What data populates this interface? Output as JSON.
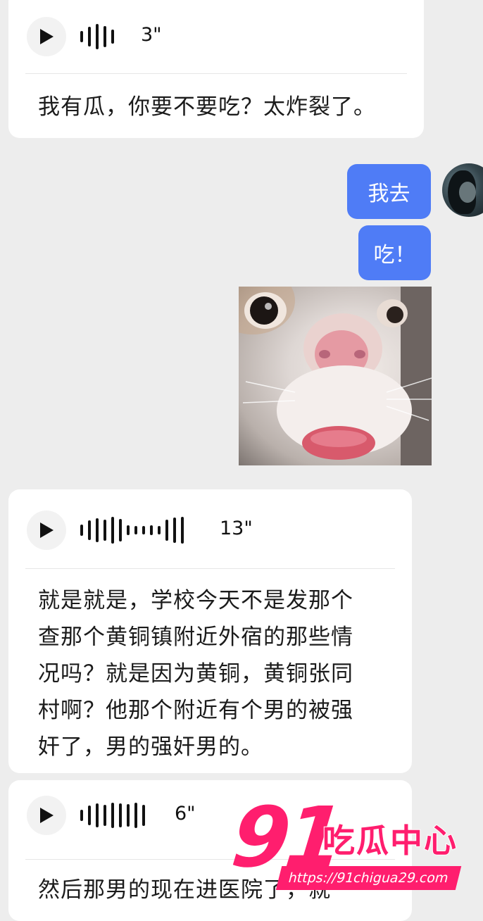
{
  "messages": {
    "voice1": {
      "duration": "3\"",
      "transcript": "我有瓜，你要不要吃？太炸裂了。"
    },
    "outgoing1": {
      "text": "我去"
    },
    "outgoing2": {
      "text": "吃！"
    },
    "voice2": {
      "duration": "13\"",
      "transcript_lines": [
        "就是就是，学校今天不是发那个",
        "查那个黄铜镇附近外宿的那些情",
        "况吗？就是因为黄铜，黄铜张同",
        "村啊？他那个附近有个男的被强",
        "奸了，男的强奸男的。"
      ]
    },
    "voice3": {
      "duration": "6\"",
      "transcript_partial": "然后那男的现在进医院了，就"
    }
  },
  "icons": {
    "play": "play-icon",
    "waveform": "voice-waveform-icon",
    "avatar": "user-avatar",
    "meme": "cat-meme-image"
  },
  "watermark": {
    "number": "91",
    "title": "吃瓜中心",
    "url": "https://91chigua29.com"
  },
  "colors": {
    "background": "#ededed",
    "incoming_bubble": "#ffffff",
    "outgoing_bubble": "#4f7cf6",
    "watermark": "#ff1e6e"
  }
}
